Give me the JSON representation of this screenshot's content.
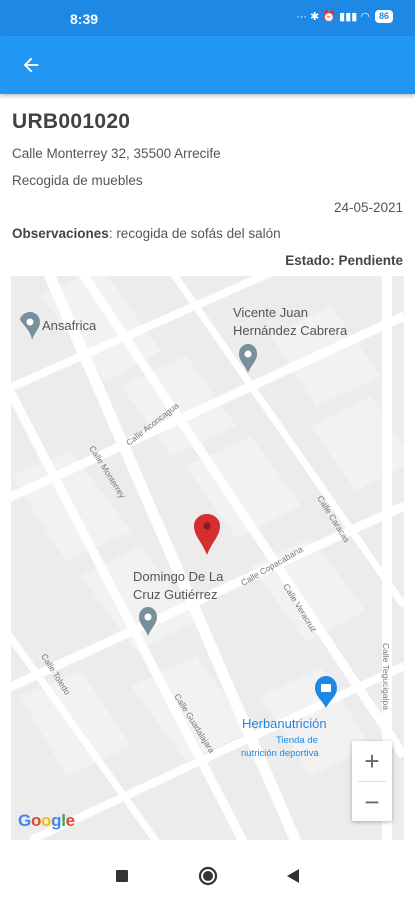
{
  "status_bar": {
    "time": "8:39",
    "icons_text": "··· ✱ ⏰ ▮▮▮ ◠",
    "battery": "86"
  },
  "app_bar": {
    "back_icon": "arrow-back-icon"
  },
  "order": {
    "code": "URB001020",
    "address": "Calle Monterrey 32, 35500 Arrecife",
    "service": "Recogida de muebles",
    "date": "24-05-2021",
    "observations_label": "Observaciones",
    "observations_text": ": recogida de sofás del salón",
    "status": "Estado: Pendiente"
  },
  "map": {
    "places": {
      "ansafrica": "Ansafrica",
      "vicente_line1": "Vicente Juan",
      "vicente_line2": "Hernández Cabrera",
      "domingo_line1": "Domingo De La",
      "domingo_line2": "Cruz Gutiérrez",
      "herbanutricion": "Herbanutrición",
      "herba_sub1": "Tienda de",
      "herba_sub2": "nutrición deportiva"
    },
    "streets": {
      "aconcagua": "Calle Aconcagua",
      "monterrey": "Calle Monterrey",
      "caracas": "Calle Caracas",
      "copacabana": "Calle Copacabana",
      "veracruz": "Calle Veracruz",
      "toledo": "Calle Toledo",
      "guadalajara": "Calle Guadalajara",
      "tegucigalpa": "Calle Tegucigalpa"
    },
    "zoom_in": "+",
    "zoom_out": "−",
    "logo": {
      "g1": "G",
      "o1": "o",
      "o2": "o",
      "g2": "g",
      "l": "l",
      "e": "e"
    },
    "colors": {
      "marker": "#d32f2f",
      "poi": "#78909c",
      "shop": "#1e88e5"
    }
  },
  "nav_bar": {
    "recent_icon": "square-icon",
    "home_icon": "circle-home-icon",
    "back_icon": "triangle-back-icon"
  }
}
